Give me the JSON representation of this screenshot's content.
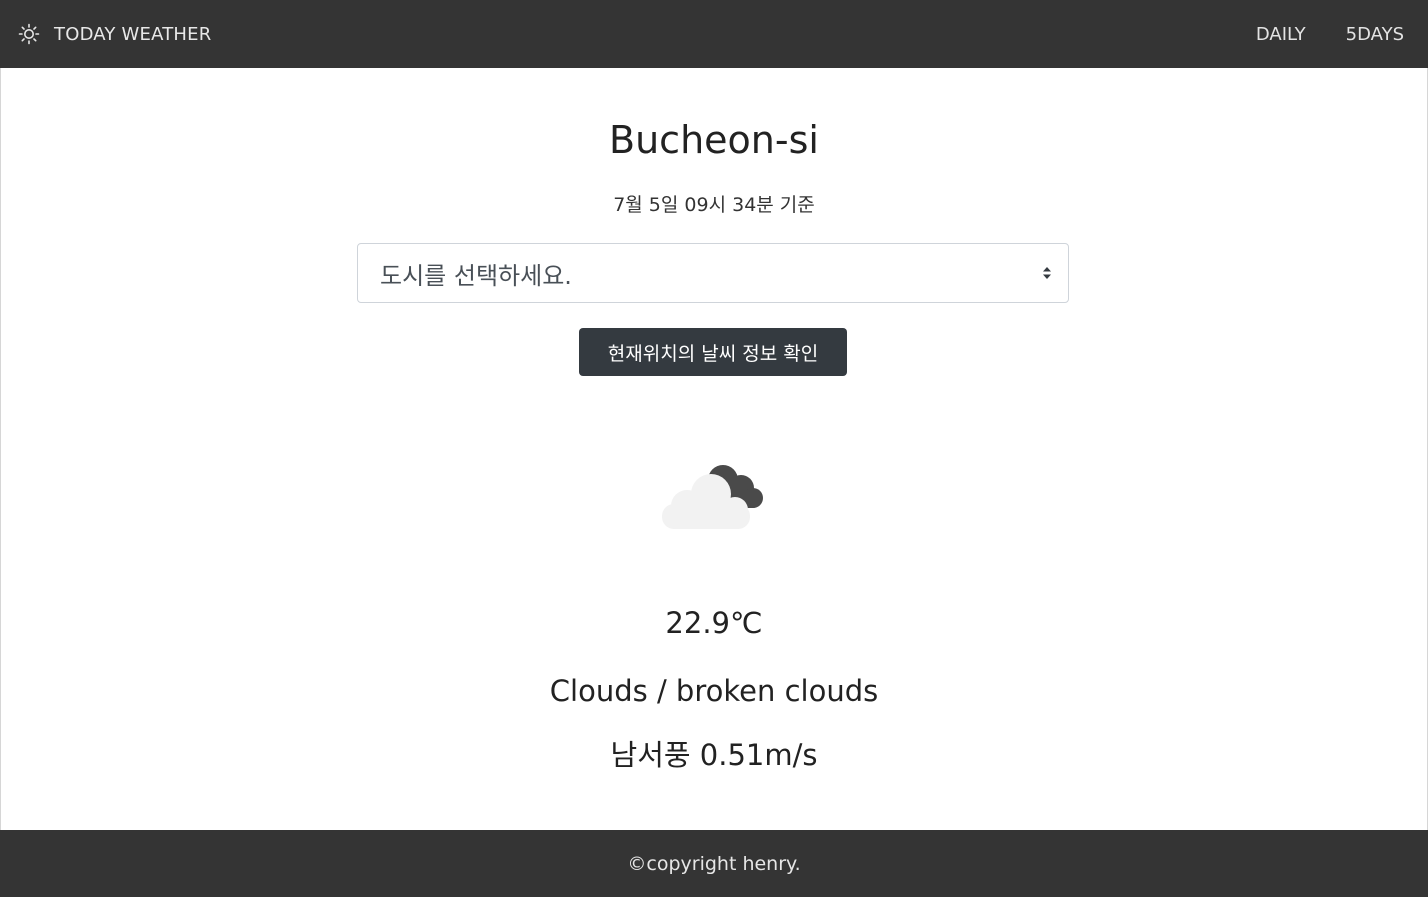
{
  "navbar": {
    "brand_icon": "sun-icon",
    "brand_label": "TODAY WEATHER",
    "links": [
      {
        "label": "DAILY"
      },
      {
        "label": "5DAYS"
      }
    ]
  },
  "main": {
    "city": "Bucheon-si",
    "timestamp": "7월 5일 09시 34분 기준",
    "city_select": {
      "selected": "도시를 선택하세요.",
      "caret_icon": "select-caret-icon"
    },
    "location_button_label": "현재위치의 날씨 정보 확인",
    "weather_icon": "broken-clouds-icon",
    "temperature": "22.9℃",
    "description": "Clouds / broken clouds",
    "wind": "남서풍 0.51m/s"
  },
  "footer": {
    "copyright": "©copyright henry."
  },
  "colors": {
    "navbar_bg": "#343434",
    "button_bg": "#343a40",
    "cloud_light": "#f2f2f2",
    "cloud_dark": "#4a4a4a"
  }
}
